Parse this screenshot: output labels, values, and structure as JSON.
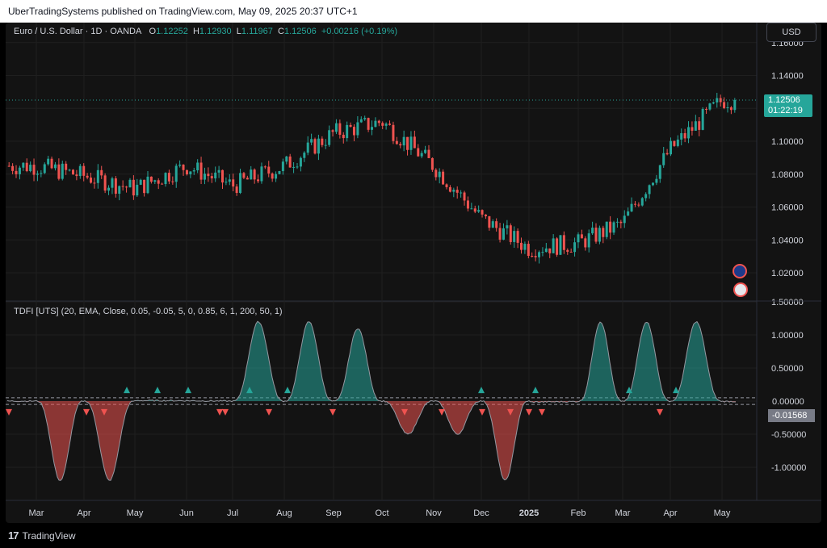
{
  "header": {
    "published": "UberTradingSystems published on TradingView.com, May 09, 2025 20:37 UTC+1"
  },
  "legend": {
    "symbol": "Euro / U.S. Dollar · 1D · OANDA",
    "o_label": "O",
    "o": "1.12252",
    "h_label": "H",
    "h": "1.12930",
    "l_label": "L",
    "l": "1.11967",
    "c_label": "C",
    "c": "1.12506",
    "change": "+0.00216 (+0.19%)"
  },
  "currency_button": "USD",
  "indicator_legend": "TDFI [UTS] (20, EMA, Close, 0.05, -0.05, 5, 0, 0.85, 6, 1, 200, 50, 1)",
  "price_tag": {
    "value": "1.12506",
    "countdown": "01:22:19"
  },
  "indicator_tags": {
    "zero": "0.00000",
    "last": "-0.01568"
  },
  "footer": {
    "brand": "TradingView",
    "logo": "17"
  },
  "colors": {
    "up": "#26a69a",
    "down": "#ef5350",
    "bg": "#131313",
    "grid": "#1f1f1f"
  },
  "chart_data": [
    {
      "type": "candlestick",
      "title": "Euro / U.S. Dollar · 1D · OANDA",
      "y_axis_labels": [
        "1.02000",
        "1.04000",
        "1.06000",
        "1.08000",
        "1.10000",
        "1.12000",
        "1.14000",
        "1.16000"
      ],
      "ylim": [
        1.01,
        1.16
      ],
      "x_axis_labels": [
        "Mar",
        "Apr",
        "May",
        "Jun",
        "Jul",
        "Aug",
        "Sep",
        "Oct",
        "Nov",
        "Dec",
        "2025",
        "Feb",
        "Mar",
        "Apr",
        "May"
      ],
      "close_path_monthly": [
        {
          "x": "Mar",
          "y": 1.085
        },
        {
          "x": "Apr",
          "y": 1.079
        },
        {
          "x": "May",
          "y": 1.071
        },
        {
          "x": "Jun",
          "y": 1.085
        },
        {
          "x": "Jul",
          "y": 1.073
        },
        {
          "x": "Aug",
          "y": 1.085
        },
        {
          "x": "Sep",
          "y": 1.105
        },
        {
          "x": "Oct",
          "y": 1.112
        },
        {
          "x": "Nov",
          "y": 1.085
        },
        {
          "x": "Dec",
          "y": 1.053
        },
        {
          "x": "2025",
          "y": 1.035
        },
        {
          "x": "Feb",
          "y": 1.038
        },
        {
          "x": "Mar",
          "y": 1.05
        },
        {
          "x": "Apr",
          "y": 1.095
        },
        {
          "x": "May",
          "y": 1.125
        }
      ],
      "grid": true
    },
    {
      "type": "area",
      "title": "TDFI [UTS] (20, EMA, Close, 0.05, -0.05, 5, 0, 0.85, 6, 1, 200, 50, 1)",
      "y_axis_labels": [
        "-1.00000",
        "-0.50000",
        "0.00000",
        "0.50000",
        "1.00000",
        "1.50000"
      ],
      "ylim": [
        -1.2,
        1.5
      ],
      "thresholds": [
        0.05,
        -0.05
      ],
      "series": [
        {
          "name": "TDFI",
          "x": [
            "Mar",
            "Apr",
            "May",
            "Jun",
            "Jul",
            "Aug",
            "Sep",
            "Oct",
            "Nov",
            "Dec",
            "2025",
            "Feb",
            "Mar",
            "Apr",
            "May"
          ],
          "values": [
            -0.05,
            -1.2,
            0.03,
            0.02,
            0.0,
            1.2,
            1.1,
            0.01,
            -0.5,
            -1.2,
            -0.05,
            -0.02,
            1.2,
            1.2,
            -0.016
          ]
        }
      ]
    }
  ]
}
